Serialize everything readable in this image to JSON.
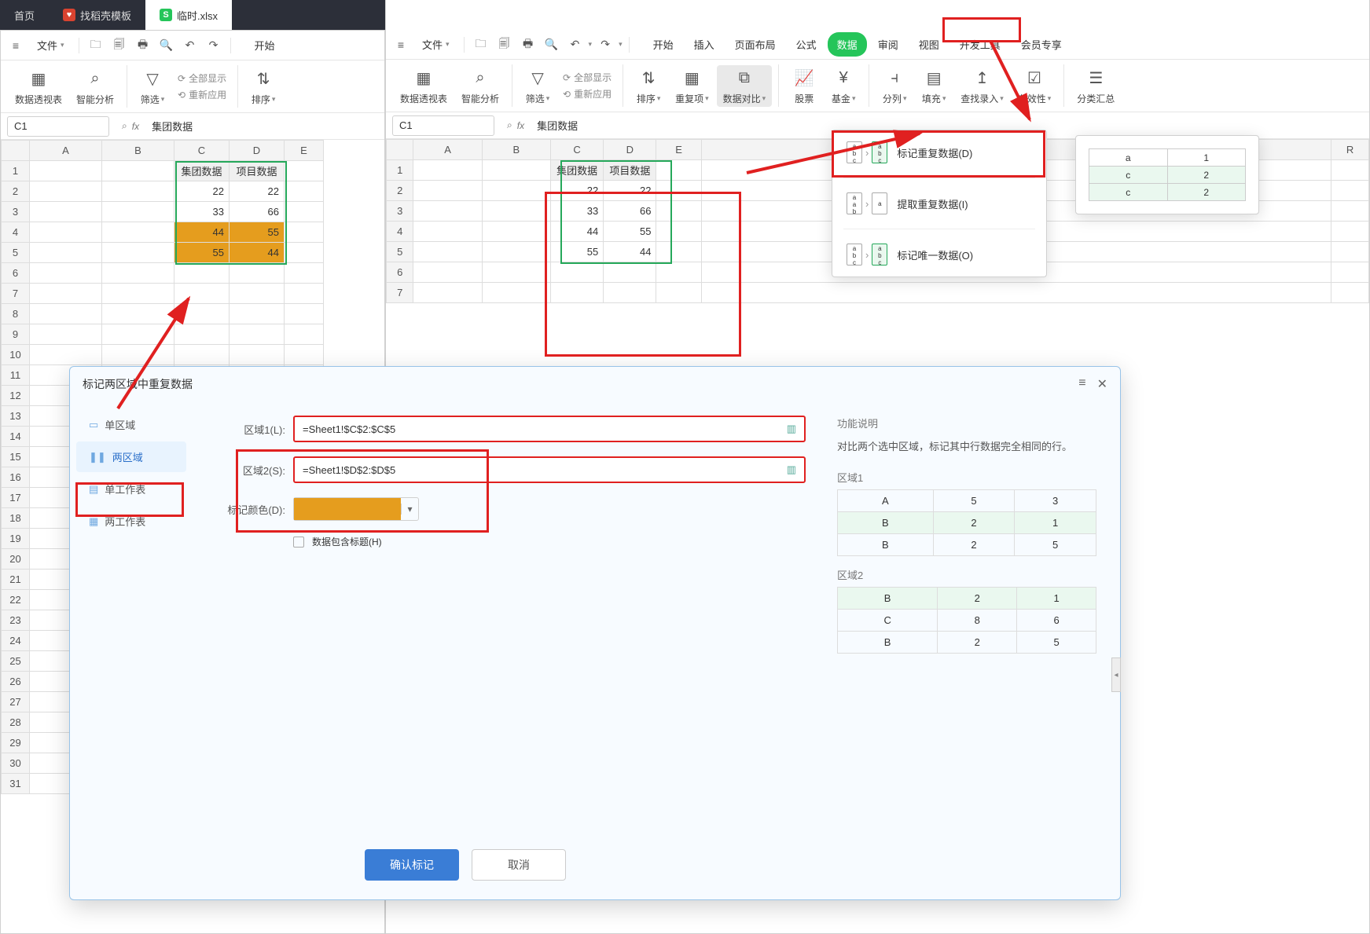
{
  "tabs": {
    "home": "首页",
    "rice": "找稻壳模板",
    "file": "临时.xlsx"
  },
  "menubar": {
    "file": "文件",
    "items_right": [
      "开始",
      "插入",
      "页面布局",
      "公式",
      "数据",
      "审阅",
      "视图",
      "开发工具",
      "会员专享"
    ],
    "items_left": [
      "开始"
    ],
    "active_right": "数据",
    "icons": [
      "home",
      "folder",
      "save",
      "print",
      "preview",
      "undo",
      "redo"
    ]
  },
  "ribbon_left": {
    "pivot": "数据透视表",
    "smart": "智能分析",
    "filter": "筛选",
    "show_all": "全部显示",
    "reapply": "重新应用",
    "sort": "排序"
  },
  "ribbon_right": {
    "pivot": "数据透视表",
    "smart": "智能分析",
    "filter": "筛选",
    "show_all": "全部显示",
    "reapply": "重新应用",
    "sort": "排序",
    "dup": "重复项",
    "cmp": "数据对比",
    "stock": "股票",
    "fund": "基金",
    "split": "分列",
    "fill": "填充",
    "lookup": "查找录入",
    "valid": "有效性",
    "group": "分类汇总"
  },
  "namebox": "C1",
  "fx_value": "集团数据",
  "grid_left": {
    "cols": [
      "A",
      "B",
      "C",
      "D",
      "E"
    ],
    "header": [
      "集团数据",
      "项目数据"
    ],
    "rows": [
      [
        22,
        22
      ],
      [
        33,
        66
      ],
      [
        44,
        55
      ],
      [
        55,
        44
      ]
    ],
    "highlight_rows": [
      3,
      4
    ]
  },
  "grid_right": {
    "cols": [
      "A",
      "B",
      "C",
      "D",
      "E"
    ],
    "header": [
      "集团数据",
      "项目数据"
    ],
    "rows": [
      [
        22,
        22
      ],
      [
        33,
        66
      ],
      [
        44,
        55
      ],
      [
        55,
        44
      ]
    ]
  },
  "dropdown": {
    "mark_dup": "标记重复数据(D)",
    "extract_dup": "提取重复数据(I)",
    "mark_unique": "标记唯一数据(O)"
  },
  "preview": {
    "rows": [
      [
        "a",
        "1"
      ],
      [
        "c",
        "2"
      ],
      [
        "c",
        "2"
      ]
    ],
    "hl": [
      1,
      2
    ]
  },
  "dialog": {
    "title": "标记两区域中重复数据",
    "side": {
      "single": "单区域",
      "double": "两区域",
      "single_sheet": "单工作表",
      "double_sheet": "两工作表"
    },
    "form": {
      "area1_label": "区域1(L):",
      "area1_val": "=Sheet1!$C$2:$C$5",
      "area2_label": "区域2(S):",
      "area2_val": "=Sheet1!$D$2:$D$5",
      "color_label": "标记颜色(D):",
      "include_title": "数据包含标题(H)"
    },
    "info": {
      "heading": "功能说明",
      "desc": "对比两个选中区域，标记其中行数据完全相同的行。",
      "t1_name": "区域1",
      "t2_name": "区域2",
      "t1": [
        [
          "A",
          "5",
          "3"
        ],
        [
          "B",
          "2",
          "1"
        ],
        [
          "B",
          "2",
          "5"
        ]
      ],
      "t1_hl": [
        1
      ],
      "t2": [
        [
          "B",
          "2",
          "1"
        ],
        [
          "C",
          "8",
          "6"
        ],
        [
          "B",
          "2",
          "5"
        ]
      ],
      "t2_hl": [
        0
      ]
    },
    "ok": "确认标记",
    "cancel": "取消"
  }
}
